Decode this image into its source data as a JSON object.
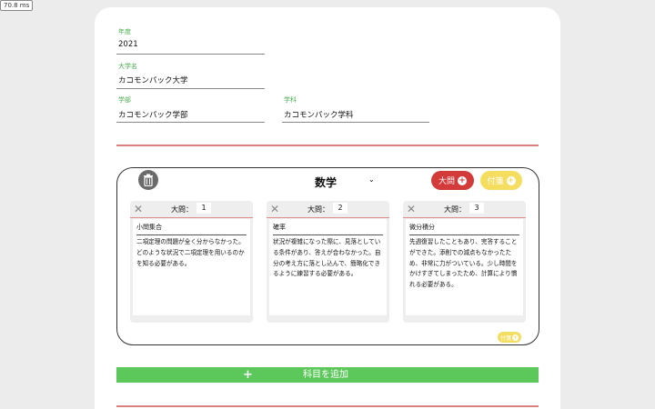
{
  "timing": "70.8 ms",
  "form": {
    "year": {
      "label": "年度",
      "value": "2021"
    },
    "university": {
      "label": "大学名",
      "value": "カコモンパック大学"
    },
    "faculty": {
      "label": "学部",
      "value": "カコモンパック学部"
    },
    "department": {
      "label": "学科",
      "value": "カコモンパック学科"
    }
  },
  "subject": {
    "title": "数学",
    "add_question_label": "大問",
    "add_note_label": "付箋",
    "note_label_small": "付箋",
    "questions": [
      {
        "label": "大問：",
        "number": "1",
        "subtopic": "小問集合",
        "text": "二項定理の問題が全く分からなかった。どのような状況で二項定理を用いるのかを知る必要がある。"
      },
      {
        "label": "大問：",
        "number": "2",
        "subtopic": "確率",
        "text": "状況が複雑になった際に、見落としている条件があり、答えが合わなかった。自分の考え方に落とし込んで、簡略化できるように練習する必要がある。"
      },
      {
        "label": "大問：",
        "number": "3",
        "subtopic": "微分積分",
        "text": "先週復習したこともあり、完答することができた。添削での減点もなかったため、非常に力がついている。少し時間をかけすぎてしまったため、計算により慣れる必要がある。"
      }
    ]
  },
  "add_subject": {
    "label": "科目を追加"
  },
  "colors": {
    "accent_green": "#5cc85c",
    "red": "#d33a3a",
    "yellow": "#f5dd5f"
  }
}
